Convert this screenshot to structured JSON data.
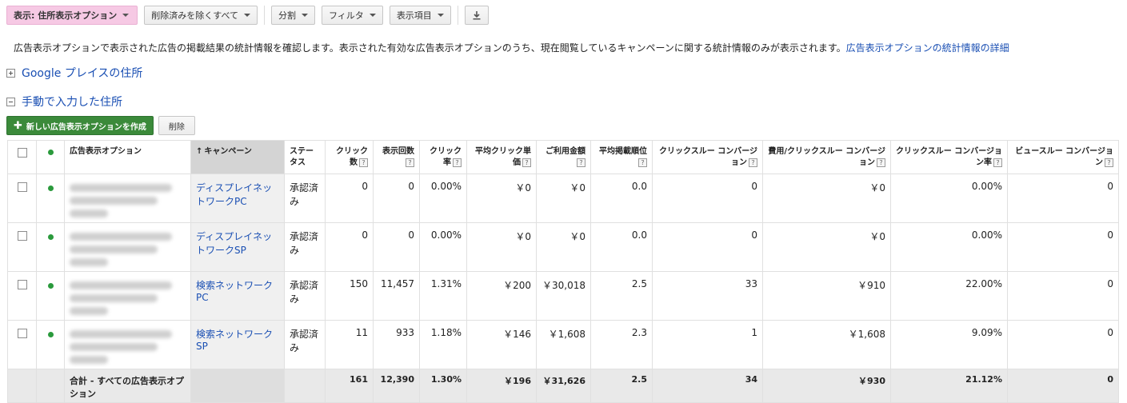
{
  "toolbar": {
    "view_label": "表示: 住所表示オプション",
    "filter_deleted_label": "削除済みを除くすべて",
    "segment_label": "分割",
    "filter_label": "フィルタ",
    "columns_label": "表示項目"
  },
  "description": {
    "text": "広告表示オプションで表示された広告の掲載結果の統計情報を確認します。表示された有効な広告表示オプションのうち、現在閲覧しているキャンペーンに関する統計情報のみが表示されます。",
    "link": "広告表示オプションの統計情報の詳細"
  },
  "sections": {
    "google_places": "Google プレイスの住所",
    "manual": "手動で入力した住所"
  },
  "actions": {
    "new_label": "新しい広告表示オプションを作成",
    "delete_label": "削除"
  },
  "table": {
    "headers": {
      "extension": "広告表示オプション",
      "campaign": "キャンペーン",
      "status": "ステータス",
      "clicks": "クリック数",
      "impressions": "表示回数",
      "ctr": "クリック率",
      "avg_cpc": "平均クリック単価",
      "cost": "ご利用金額",
      "avg_pos": "平均掲載順位",
      "conv": "クリックスルー コンバージョン",
      "cost_per_conv": "費用/クリックスルー コンバージョン",
      "conv_rate": "クリックスルー コンバージョン率",
      "view_conv": "ビュースルー コンバージョン"
    },
    "help_icon": "?",
    "rows": [
      {
        "campaign": "ディスプレイネットワークPC",
        "status": "承認済み",
        "clicks": "0",
        "impressions": "0",
        "ctr": "0.00%",
        "avg_cpc": "￥0",
        "cost": "￥0",
        "avg_pos": "0.0",
        "conv": "0",
        "cost_per_conv": "￥0",
        "conv_rate": "0.00%",
        "view_conv": "0"
      },
      {
        "campaign": "ディスプレイネットワークSP",
        "status": "承認済み",
        "clicks": "0",
        "impressions": "0",
        "ctr": "0.00%",
        "avg_cpc": "￥0",
        "cost": "￥0",
        "avg_pos": "0.0",
        "conv": "0",
        "cost_per_conv": "￥0",
        "conv_rate": "0.00%",
        "view_conv": "0"
      },
      {
        "campaign": "検索ネットワークPC",
        "status": "承認済み",
        "clicks": "150",
        "impressions": "11,457",
        "ctr": "1.31%",
        "avg_cpc": "￥200",
        "cost": "￥30,018",
        "avg_pos": "2.5",
        "conv": "33",
        "cost_per_conv": "￥910",
        "conv_rate": "22.00%",
        "view_conv": "0"
      },
      {
        "campaign": "検索ネットワークSP",
        "status": "承認済み",
        "clicks": "11",
        "impressions": "933",
        "ctr": "1.18%",
        "avg_cpc": "￥146",
        "cost": "￥1,608",
        "avg_pos": "2.3",
        "conv": "1",
        "cost_per_conv": "￥1,608",
        "conv_rate": "9.09%",
        "view_conv": "0"
      }
    ],
    "total": {
      "label": "合計 - すべての広告表示オプション",
      "clicks": "161",
      "impressions": "12,390",
      "ctr": "1.30%",
      "avg_cpc": "￥196",
      "cost": "￥31,626",
      "avg_pos": "2.5",
      "conv": "34",
      "cost_per_conv": "￥930",
      "conv_rate": "21.12%",
      "view_conv": "0"
    }
  },
  "colors": {
    "accent_link": "#1a4fb3",
    "highlight_button": "#f6c9e4",
    "primary_button": "#3b8a3a",
    "status_enabled": "#2a9a3c"
  },
  "icons": {
    "download": "download-icon",
    "expand": "plus-box-icon",
    "collapse": "minus-box-icon",
    "sort": "sort-up-arrow-icon"
  }
}
